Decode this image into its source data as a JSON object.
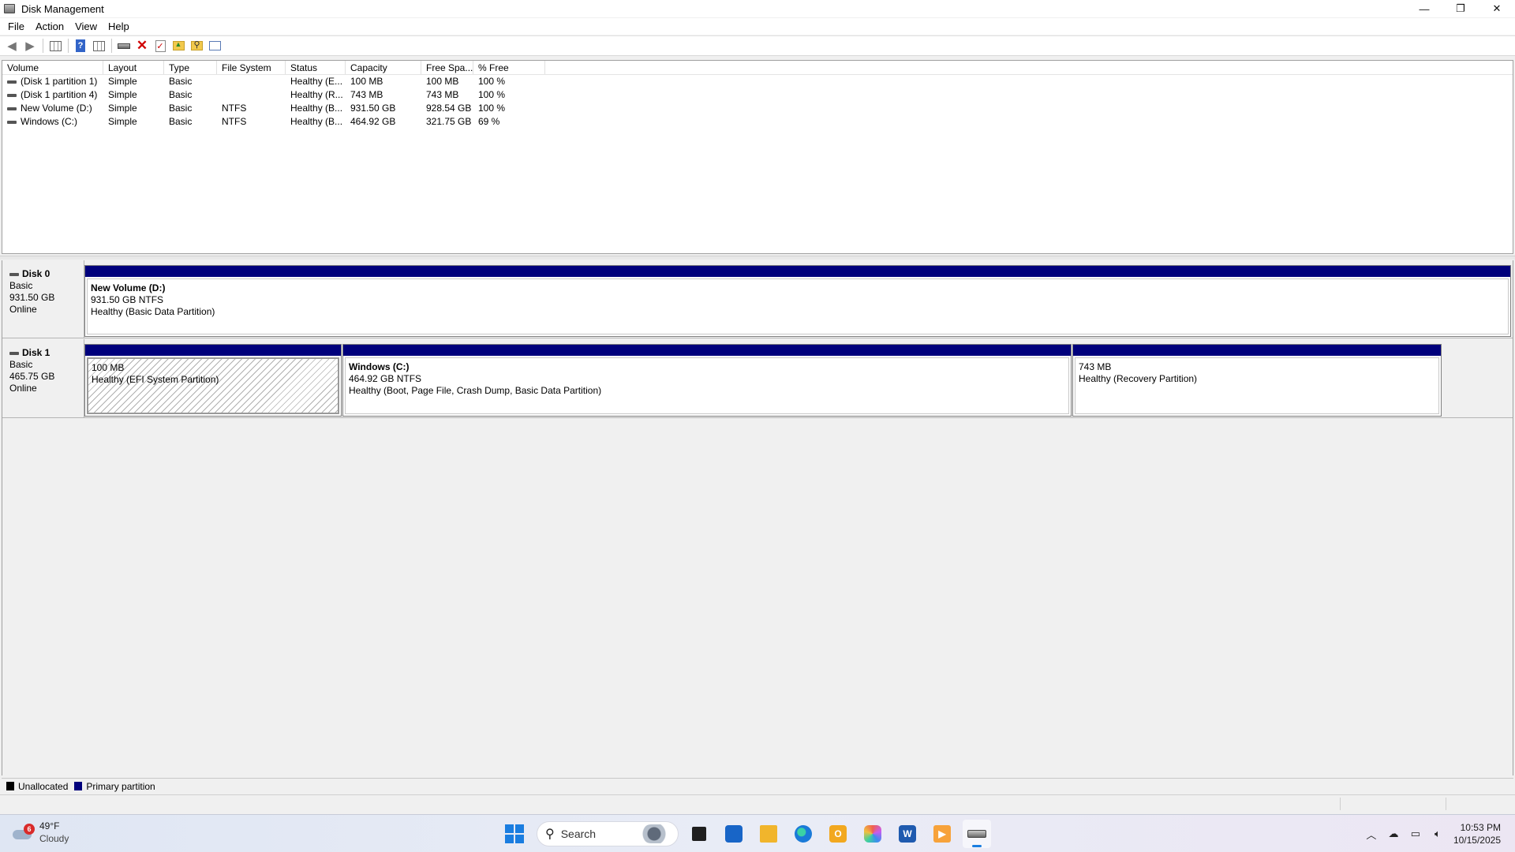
{
  "window": {
    "title": "Disk Management",
    "minimize": "—",
    "maximize": "❐",
    "close": "✕"
  },
  "menu": [
    "File",
    "Action",
    "View",
    "Help"
  ],
  "columns": [
    "Volume",
    "Layout",
    "Type",
    "File System",
    "Status",
    "Capacity",
    "Free Spa...",
    "% Free"
  ],
  "volumes": [
    {
      "volume": "(Disk 1 partition 1)",
      "layout": "Simple",
      "type": "Basic",
      "fs": "",
      "status": "Healthy (E...",
      "capacity": "100 MB",
      "free": "100 MB",
      "pct": "100 %"
    },
    {
      "volume": "(Disk 1 partition 4)",
      "layout": "Simple",
      "type": "Basic",
      "fs": "",
      "status": "Healthy (R...",
      "capacity": "743 MB",
      "free": "743 MB",
      "pct": "100 %"
    },
    {
      "volume": "New Volume (D:)",
      "layout": "Simple",
      "type": "Basic",
      "fs": "NTFS",
      "status": "Healthy (B...",
      "capacity": "931.50 GB",
      "free": "928.54 GB",
      "pct": "100 %"
    },
    {
      "volume": "Windows (C:)",
      "layout": "Simple",
      "type": "Basic",
      "fs": "NTFS",
      "status": "Healthy (B...",
      "capacity": "464.92 GB",
      "free": "321.75 GB",
      "pct": "69 %"
    }
  ],
  "disks": [
    {
      "name": "Disk 0",
      "type": "Basic",
      "size": "931.50 GB",
      "state": "Online",
      "partitions": [
        {
          "name": "New Volume  (D:)",
          "size": "931.50 GB NTFS",
          "status": "Healthy (Basic Data Partition)"
        }
      ]
    },
    {
      "name": "Disk 1",
      "type": "Basic",
      "size": "465.75 GB",
      "state": "Online",
      "partitions": [
        {
          "name": "",
          "size": "100 MB",
          "status": "Healthy (EFI System Partition)"
        },
        {
          "name": "Windows  (C:)",
          "size": "464.92 GB NTFS",
          "status": "Healthy (Boot, Page File, Crash Dump, Basic Data Partition)"
        },
        {
          "name": "",
          "size": "743 MB",
          "status": "Healthy (Recovery Partition)"
        }
      ]
    }
  ],
  "legend": [
    {
      "label": "Unallocated",
      "color": "#000000"
    },
    {
      "label": "Primary partition",
      "color": "#00007c"
    }
  ],
  "taskbar": {
    "weather": {
      "temp": "49°F",
      "condition": "Cloudy",
      "badge": "6"
    },
    "search_label": "Search",
    "time": "10:53 PM",
    "date": "10/15/2025",
    "apps": [
      "task-view",
      "microsoft-store",
      "file-explorer",
      "edge",
      "outlook",
      "copilot",
      "word",
      "media-player",
      "disk-management"
    ]
  },
  "colors": {
    "primary_partition": "#00007c",
    "accent": "#1a7de0"
  }
}
